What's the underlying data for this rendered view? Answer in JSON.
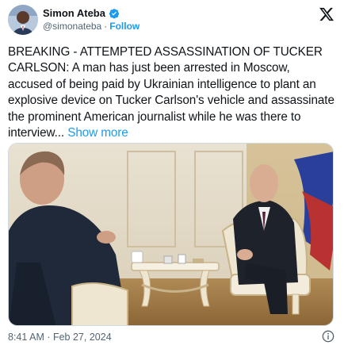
{
  "author": {
    "display_name": "Simon Ateba",
    "handle": "@simonateba",
    "follow_label": "Follow",
    "separator": "·",
    "verified_color": "#1d9bf0"
  },
  "brand_icon": "x-logo-icon",
  "tweet": {
    "text": "BREAKING - ATTEMPTED ASSASSINATION OF TUCKER CARLSON: A man has just been arrested in Moscow, accused of being paid by Ukrainian intelligence to plant an explosive device on Tucker Carlson's vehicle and assassinate the prominent American journalist while he was there to interview...",
    "show_more_label": "Show more",
    "link_color": "#1d9bf0"
  },
  "media": {
    "type": "photo"
  },
  "footer": {
    "timestamp": "8:41 AM · Feb 27, 2024",
    "info_icon": "info-icon"
  }
}
